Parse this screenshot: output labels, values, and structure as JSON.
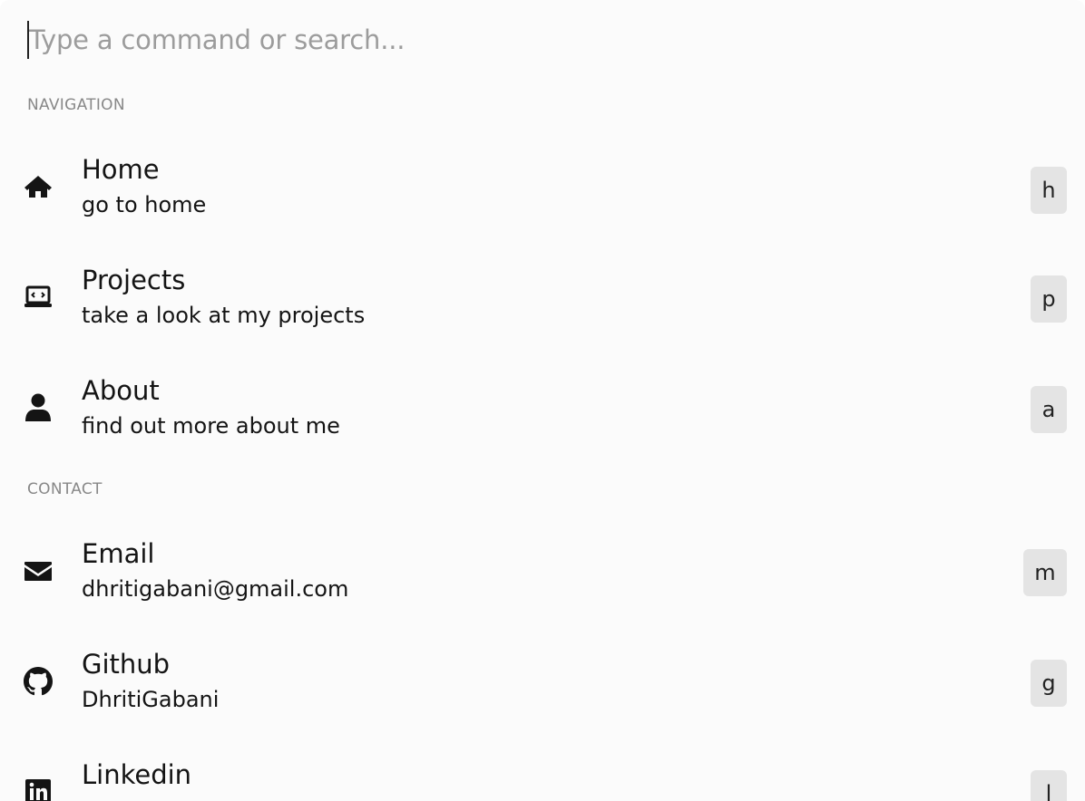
{
  "search": {
    "placeholder": "Type a command or search..."
  },
  "sections": {
    "navigation": "NAVIGATION",
    "contact": "CONTACT"
  },
  "items": {
    "home": {
      "title": "Home",
      "subtitle": "go to home",
      "shortcut": "h",
      "icon": "home-icon"
    },
    "projects": {
      "title": "Projects",
      "subtitle": "take a look at my projects",
      "shortcut": "p",
      "icon": "laptop-code-icon"
    },
    "about": {
      "title": "About",
      "subtitle": "find out more about me",
      "shortcut": "a",
      "icon": "user-icon"
    },
    "email": {
      "title": "Email",
      "subtitle": "dhritigabani@gmail.com",
      "shortcut": "m",
      "icon": "envelope-icon"
    },
    "github": {
      "title": "Github",
      "subtitle": "DhritiGabani",
      "shortcut": "g",
      "icon": "github-icon"
    },
    "linkedin": {
      "title": "Linkedin",
      "subtitle": "",
      "shortcut": "l",
      "icon": "linkedin-icon"
    }
  },
  "colors": {
    "background": "#fbfbfb",
    "text": "#141414",
    "muted": "#888888",
    "kbd_bg": "#e4e4e4"
  }
}
